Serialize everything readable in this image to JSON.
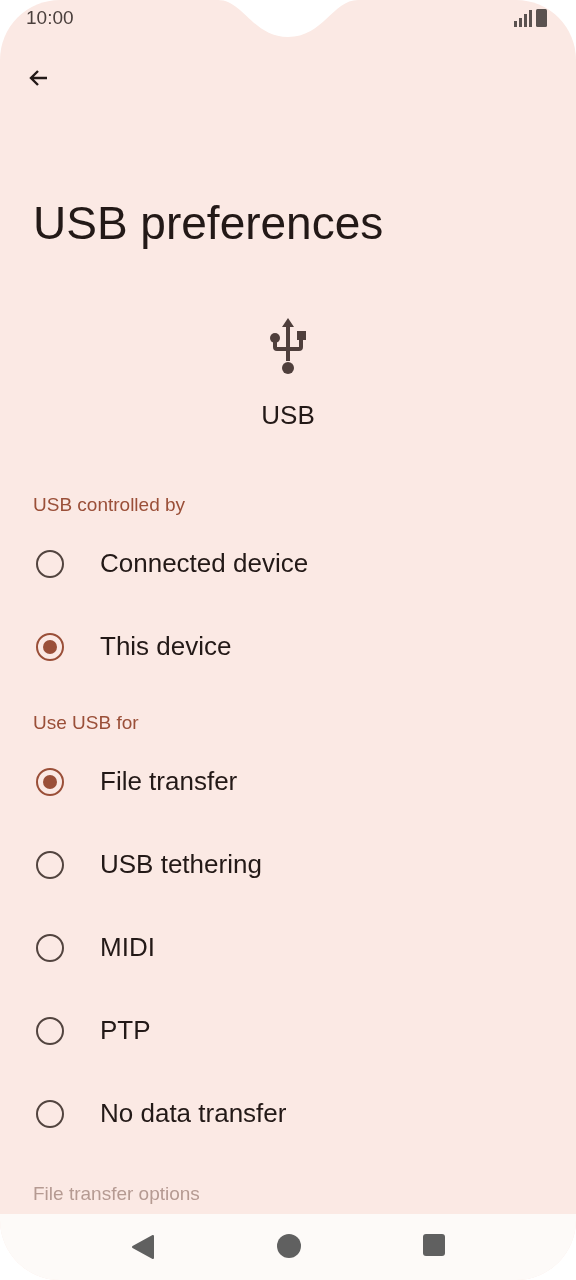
{
  "status_bar": {
    "time": "10:00"
  },
  "title": "USB preferences",
  "header": {
    "label": "USB"
  },
  "sections": [
    {
      "title": "USB controlled by",
      "options": [
        {
          "label": "Connected device",
          "selected": false
        },
        {
          "label": "This device",
          "selected": true
        }
      ]
    },
    {
      "title": "Use USB for",
      "options": [
        {
          "label": "File transfer",
          "selected": true
        },
        {
          "label": "USB tethering",
          "selected": false
        },
        {
          "label": "MIDI",
          "selected": false
        },
        {
          "label": "PTP",
          "selected": false
        },
        {
          "label": "No data transfer",
          "selected": false
        }
      ]
    }
  ],
  "next_section_title": "File transfer options"
}
